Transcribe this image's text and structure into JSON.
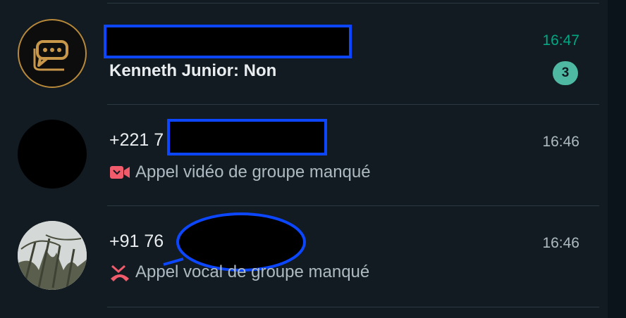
{
  "chats": [
    {
      "name_redacted": true,
      "preview": "Kenneth Junior: Non",
      "time": "16:47",
      "unread": "3",
      "avatar": "chat-bubbles-logo"
    },
    {
      "name_prefix": "+221 7",
      "preview_icon": "missed-video-call-icon",
      "preview": "Appel vidéo de groupe manqué",
      "time": "16:46",
      "avatar": "redacted-black"
    },
    {
      "name_prefix": "+91 76",
      "preview_icon": "missed-voice-call-icon",
      "preview": "Appel vocal de groupe manqué",
      "time": "16:46",
      "avatar": "nature-photo"
    }
  ],
  "colors": {
    "background": "#111b21",
    "accent": "#00a884",
    "badge": "#4fb8a3",
    "missed": "#f15c6d",
    "redaction_outline": "#0c47ff"
  }
}
